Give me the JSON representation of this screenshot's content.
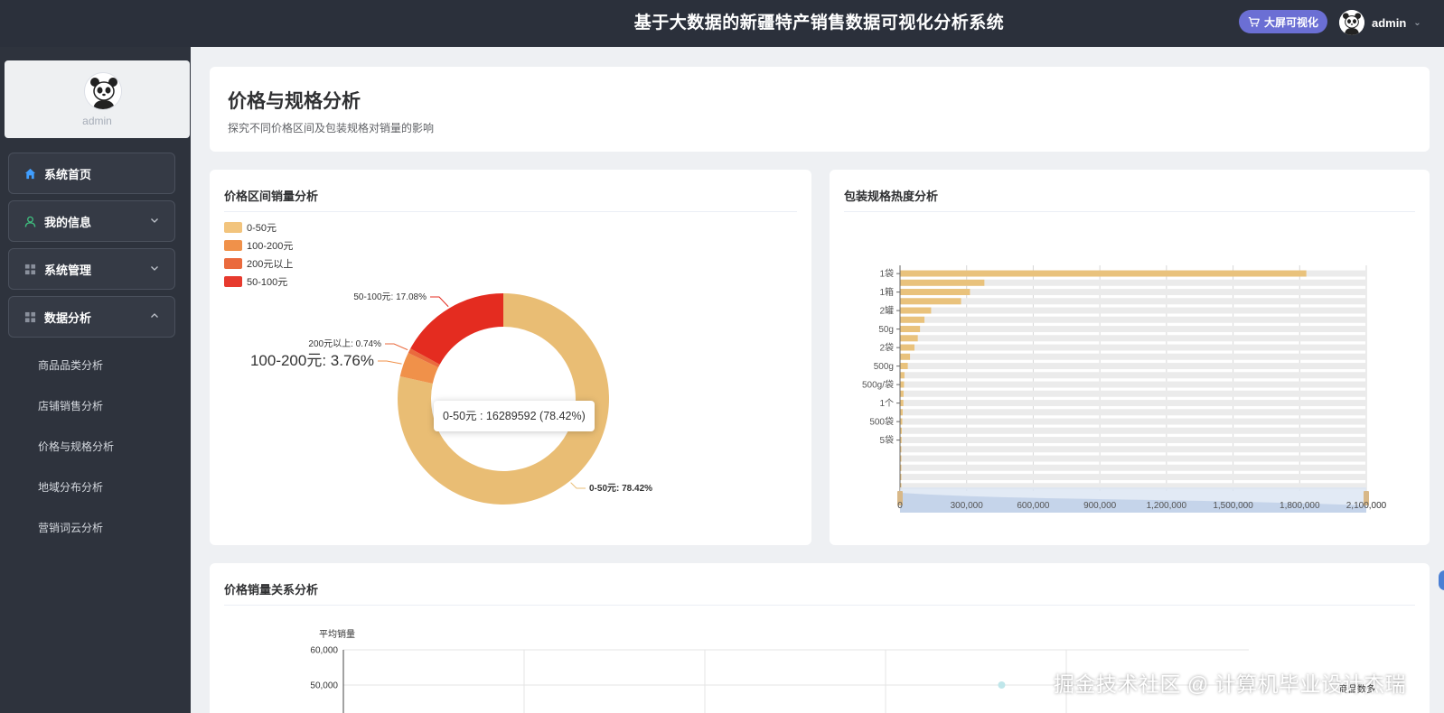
{
  "header": {
    "system_title": "基于大数据的新疆特产销售数据可视化分析系统",
    "big_screen_label": "大屏可视化",
    "username": "admin"
  },
  "sidebar": {
    "profile_name": "admin",
    "menu": [
      {
        "label": "系统首页",
        "icon": "home-icon"
      },
      {
        "label": "我的信息",
        "icon": "user-icon"
      },
      {
        "label": "系统管理",
        "icon": "grid-icon"
      },
      {
        "label": "数据分析",
        "icon": "grid-icon"
      }
    ],
    "submenu": [
      "商品品类分析",
      "店铺销售分析",
      "价格与规格分析",
      "地域分布分析",
      "营销词云分析"
    ]
  },
  "page": {
    "title": "价格与规格分析",
    "subtitle": "探究不同价格区间及包装规格对销量的影响"
  },
  "pie_card": {
    "title": "价格区间销量分析"
  },
  "bar_card": {
    "title": "包装规格热度分析"
  },
  "scatter_card": {
    "title": "价格销量关系分析"
  },
  "tooltip": {
    "text": "0-50元 : 16289592 (78.42%)"
  },
  "watermark": "掘金技术社区 @ 计算机毕业设计杰瑞",
  "chart_data": [
    {
      "type": "pie",
      "title": "价格区间销量分析",
      "legend_position": "top-left",
      "slices": [
        {
          "name": "0-50元",
          "percent": 78.42,
          "value": 16289592,
          "label": "0-50元: 78.42%",
          "color": "#e9bd74"
        },
        {
          "name": "100-200元",
          "percent": 3.76,
          "label": "100-200元: 3.76%",
          "color": "#f0914a"
        },
        {
          "name": "200元以上",
          "percent": 0.74,
          "label": "200元以上: 0.74%",
          "color": "#ea6a3d"
        },
        {
          "name": "50-100元",
          "percent": 17.08,
          "label": "50-100元: 17.08%",
          "color": "#e42c20"
        }
      ],
      "legend": [
        {
          "name": "0-50元",
          "color": "#f2c47d"
        },
        {
          "name": "100-200元",
          "color": "#f0914a"
        },
        {
          "name": "200元以上",
          "color": "#ea6a3d"
        },
        {
          "name": "50-100元",
          "color": "#e73a2e"
        }
      ]
    },
    {
      "type": "bar",
      "orientation": "horizontal",
      "title": "包装规格热度分析",
      "xlim": [
        0,
        2100000
      ],
      "x_ticks": [
        "0",
        "300,000",
        "600,000",
        "900,000",
        "1,200,000",
        "1,500,000",
        "1,800,000",
        "2,100,000"
      ],
      "y_tick_labels": [
        "1袋",
        "1箱",
        "2罐",
        "50g",
        "2袋",
        "500g",
        "500g/袋",
        "1个",
        "500袋",
        "5袋"
      ],
      "values": [
        1830000,
        380000,
        315000,
        275000,
        140000,
        110000,
        90000,
        80000,
        65000,
        45000,
        35000,
        20000,
        18000,
        16000,
        15000,
        12000,
        10000,
        8000,
        7000,
        6000,
        5000,
        4000,
        3000,
        2000
      ],
      "bar_color": "#e9c27c",
      "background_bar_color": "#ebebeb",
      "grid": true,
      "data_zoom": true
    },
    {
      "type": "scatter",
      "title": "价格销量关系分析",
      "ylabel": "平均销量",
      "xlabel": "商品数多",
      "y_ticks": [
        "60,000",
        "50,000"
      ],
      "points": [
        {
          "x_fraction": 0.727,
          "y": 50000
        }
      ]
    }
  ]
}
